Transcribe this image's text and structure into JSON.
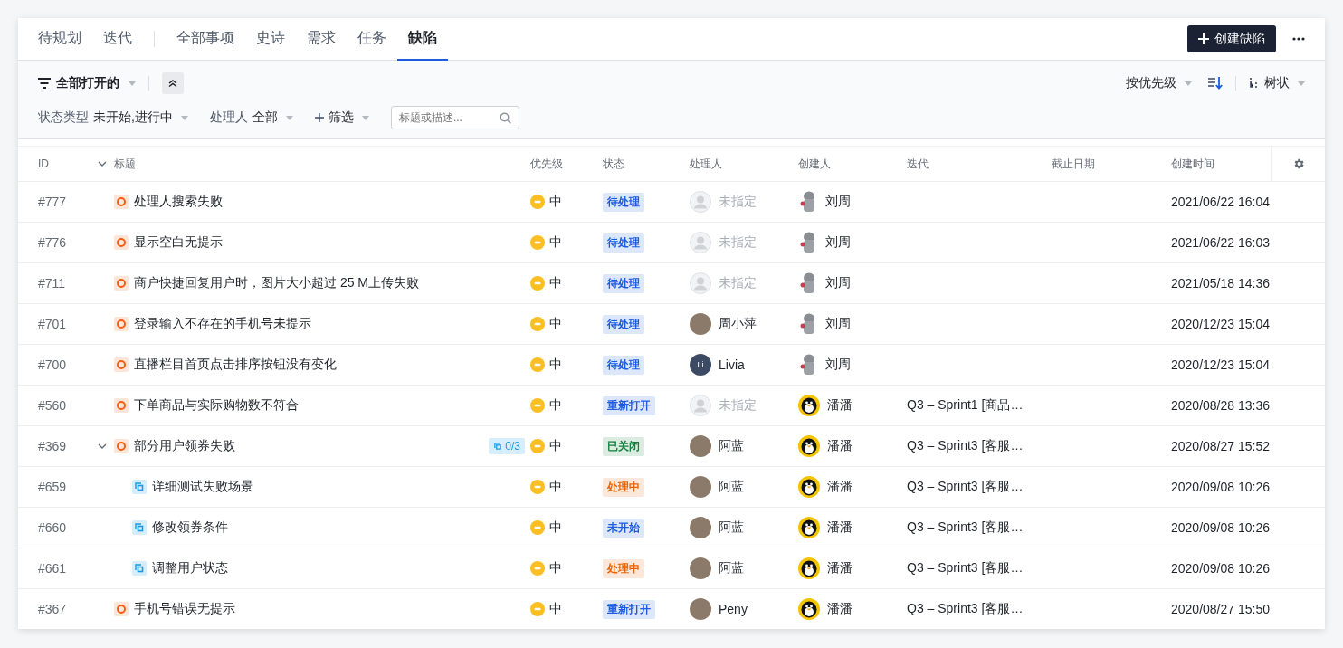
{
  "nav": {
    "groups": [
      [
        {
          "label": "待规划",
          "selected": false
        },
        {
          "label": "迭代",
          "selected": false
        }
      ],
      [
        {
          "label": "全部事项",
          "selected": false
        },
        {
          "label": "史诗",
          "selected": false
        },
        {
          "label": "需求",
          "selected": false
        },
        {
          "label": "任务",
          "selected": false
        },
        {
          "label": "缺陷",
          "selected": true
        }
      ]
    ],
    "create_button": "创建缺陷"
  },
  "filters": {
    "view": "全部打开的",
    "collapsed": false,
    "sort": "按优先级",
    "layout": "树状",
    "fields": [
      {
        "label": "状态类型",
        "value": "未开始,进行中"
      },
      {
        "label": "处理人",
        "value": "全部"
      }
    ],
    "add_filter": "筛选",
    "search": {
      "placeholder": "标题或描述..."
    }
  },
  "table": {
    "columns": [
      "ID",
      "标题",
      "优先级",
      "状态",
      "处理人",
      "创建人",
      "迭代",
      "截止日期",
      "创建时间"
    ],
    "rows": [
      {
        "id": "#777",
        "kind": "bug",
        "title": "处理人搜索失败",
        "priority": "中",
        "status": {
          "label": "待处理",
          "color": "#1d5ce0"
        },
        "assignee": {
          "name": "未指定",
          "kind": "none"
        },
        "creator": {
          "name": "刘周",
          "kind": "figure"
        },
        "created": "2021/06/22 16:04"
      },
      {
        "id": "#776",
        "kind": "bug",
        "title": "显示空白无提示",
        "priority": "中",
        "status": {
          "label": "待处理",
          "color": "#1d5ce0"
        },
        "assignee": {
          "name": "未指定",
          "kind": "none"
        },
        "creator": {
          "name": "刘周",
          "kind": "figure"
        },
        "created": "2021/06/22 16:03"
      },
      {
        "id": "#711",
        "kind": "bug",
        "title": "商户快捷回复用户时，图片大小超过 25 M上传失败",
        "priority": "中",
        "status": {
          "label": "待处理",
          "color": "#1d5ce0"
        },
        "assignee": {
          "name": "未指定",
          "kind": "none"
        },
        "creator": {
          "name": "刘周",
          "kind": "figure"
        },
        "created": "2021/05/18 14:36"
      },
      {
        "id": "#701",
        "kind": "bug",
        "title": "登录输入不存在的手机号未提示",
        "priority": "中",
        "status": {
          "label": "待处理",
          "color": "#1d5ce0"
        },
        "assignee": {
          "name": "周小萍",
          "kind": "photo"
        },
        "creator": {
          "name": "刘周",
          "kind": "figure"
        },
        "created": "2020/12/23 15:04"
      },
      {
        "id": "#700",
        "kind": "bug",
        "title": "直播栏目首页点击排序按钮没有变化",
        "priority": "中",
        "status": {
          "label": "待处理",
          "color": "#1d5ce0"
        },
        "assignee": {
          "name": "Livia",
          "kind": "initials",
          "initials": "Li"
        },
        "creator": {
          "name": "刘周",
          "kind": "figure"
        },
        "created": "2020/12/23 15:04"
      },
      {
        "id": "#560",
        "kind": "bug",
        "title": "下单商品与实际购物数不符合",
        "priority": "中",
        "status": {
          "label": "重新打开",
          "color": "#1d5ce0"
        },
        "assignee": {
          "name": "未指定",
          "kind": "none"
        },
        "creator": {
          "name": "潘潘",
          "kind": "penguin"
        },
        "iteration": "Q3 – Sprint1 [商品…",
        "created": "2020/08/28 13:36"
      },
      {
        "id": "#369",
        "kind": "bug",
        "title": "部分用户领券失败",
        "expanded": true,
        "subtasks": "0/3",
        "priority": "中",
        "status": {
          "label": "已关闭",
          "color": "#16803c"
        },
        "assignee": {
          "name": "阿蓝",
          "kind": "photo"
        },
        "creator": {
          "name": "潘潘",
          "kind": "penguin"
        },
        "iteration": "Q3 – Sprint3 [客服…",
        "created": "2020/08/27 15:52",
        "children": [
          {
            "id": "#659",
            "kind": "subtask",
            "title": "详细测试失败场景",
            "priority": "中",
            "status": {
              "label": "处理中",
              "color": "#e8650a"
            },
            "assignee": {
              "name": "阿蓝",
              "kind": "photo"
            },
            "creator": {
              "name": "潘潘",
              "kind": "penguin"
            },
            "iteration": "Q3 – Sprint3 [客服…",
            "created": "2020/09/08 10:26"
          },
          {
            "id": "#660",
            "kind": "subtask",
            "title": "修改领券条件",
            "priority": "中",
            "status": {
              "label": "未开始",
              "color": "#1d5ce0"
            },
            "assignee": {
              "name": "阿蓝",
              "kind": "photo"
            },
            "creator": {
              "name": "潘潘",
              "kind": "penguin"
            },
            "iteration": "Q3 – Sprint3 [客服…",
            "created": "2020/09/08 10:26"
          },
          {
            "id": "#661",
            "kind": "subtask",
            "title": "调整用户状态",
            "priority": "中",
            "status": {
              "label": "处理中",
              "color": "#e8650a"
            },
            "assignee": {
              "name": "阿蓝",
              "kind": "photo"
            },
            "creator": {
              "name": "潘潘",
              "kind": "penguin"
            },
            "iteration": "Q3 – Sprint3 [客服…",
            "created": "2020/09/08 10:26"
          }
        ]
      },
      {
        "id": "#367",
        "kind": "bug",
        "title": "手机号错误无提示",
        "priority": "中",
        "status": {
          "label": "重新打开",
          "color": "#1d5ce0"
        },
        "assignee": {
          "name": "Peny",
          "kind": "photo"
        },
        "creator": {
          "name": "潘潘",
          "kind": "penguin"
        },
        "iteration": "Q3 – Sprint3 [客服…",
        "created": "2020/08/27 15:50"
      }
    ]
  }
}
